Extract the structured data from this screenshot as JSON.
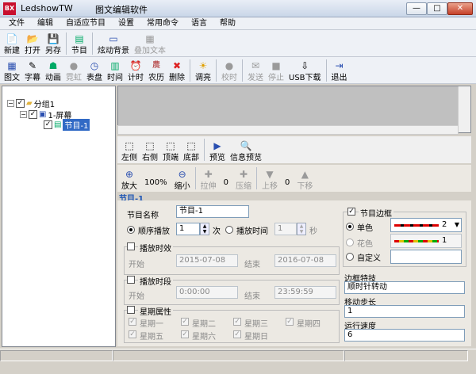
{
  "title": {
    "app": "LedshowTW",
    "doc": "图文编辑软件"
  },
  "menu": [
    "文件",
    "编辑",
    "自适应节目",
    "设置",
    "常用命令",
    "语言",
    "帮助"
  ],
  "toolbar1": [
    {
      "label": "新建",
      "icon": "📄"
    },
    {
      "label": "打开",
      "icon": "📂"
    },
    {
      "label": "另存",
      "icon": "💾"
    },
    {
      "label": "节目",
      "icon": "▤"
    },
    {
      "label": "炫动背景",
      "icon": "▭"
    },
    {
      "label": "叠加文本",
      "icon": "▦"
    }
  ],
  "toolbar2": [
    {
      "label": "图文",
      "icon": "▦"
    },
    {
      "label": "字幕",
      "icon": "✎"
    },
    {
      "label": "动画",
      "icon": "☗"
    },
    {
      "label": "霓虹",
      "icon": "●"
    },
    {
      "label": "表盘",
      "icon": "◷"
    },
    {
      "label": "时间",
      "icon": "▥"
    },
    {
      "label": "计时",
      "icon": "⏰"
    },
    {
      "label": "农历",
      "icon": "農"
    },
    {
      "label": "删除",
      "icon": "✖"
    },
    {
      "label": "调亮",
      "icon": "☀"
    },
    {
      "label": "校时",
      "icon": "●"
    },
    {
      "label": "发送",
      "icon": "✉"
    },
    {
      "label": "停止",
      "icon": "■"
    },
    {
      "label": "USB下载",
      "icon": "⇩"
    },
    {
      "label": "退出",
      "icon": "⇥"
    }
  ],
  "tree": {
    "group": "分组1",
    "screen": "1-屏幕",
    "program": "节目-1"
  },
  "panel1": [
    {
      "label": "左侧",
      "icon": "⬚"
    },
    {
      "label": "右侧",
      "icon": "⬚"
    },
    {
      "label": "顶端",
      "icon": "⬚"
    },
    {
      "label": "底部",
      "icon": "⬚"
    },
    {
      "label": "预览",
      "icon": "▶"
    },
    {
      "label": "信息预览",
      "icon": "🔍"
    }
  ],
  "panel2": {
    "zoom_in": "放大",
    "zoom_pct": "100%",
    "zoom_out": "缩小",
    "stretch": "拉伸",
    "stretch_val": "0",
    "compress": "压缩",
    "up": "上移",
    "up_val": "0",
    "down": "下移"
  },
  "form": {
    "heading": "节目-1",
    "name_label": "节目名称",
    "name_value": "节目-1",
    "seq_play": "顺序播放",
    "seq_count": "1",
    "times": "次",
    "play_time": "播放时间",
    "play_time_val": "1",
    "seconds": "秒",
    "validity": "播放时效",
    "start": "开始",
    "end": "结束",
    "start_date": "2015-07-08",
    "end_date": "2016-07-08",
    "period": "播放时段",
    "start_time": "0:00:00",
    "end_time": "23:59:59",
    "weekday": "星期属性",
    "days": [
      "星期一",
      "星期二",
      "星期三",
      "星期四",
      "星期五",
      "星期六",
      "星期日"
    ]
  },
  "border": {
    "title": "节目边框",
    "single": "单色",
    "single_val": "2",
    "flower": "花色",
    "flower_val": "1",
    "custom": "自定义",
    "effect_label": "边框特技",
    "effect_value": "顺时针转动",
    "step_label": "移动步长",
    "step_value": "1",
    "speed_label": "运行速度",
    "speed_value": "6"
  },
  "colors": {
    "accent": "#316ac5",
    "heading": "#2057b4"
  }
}
